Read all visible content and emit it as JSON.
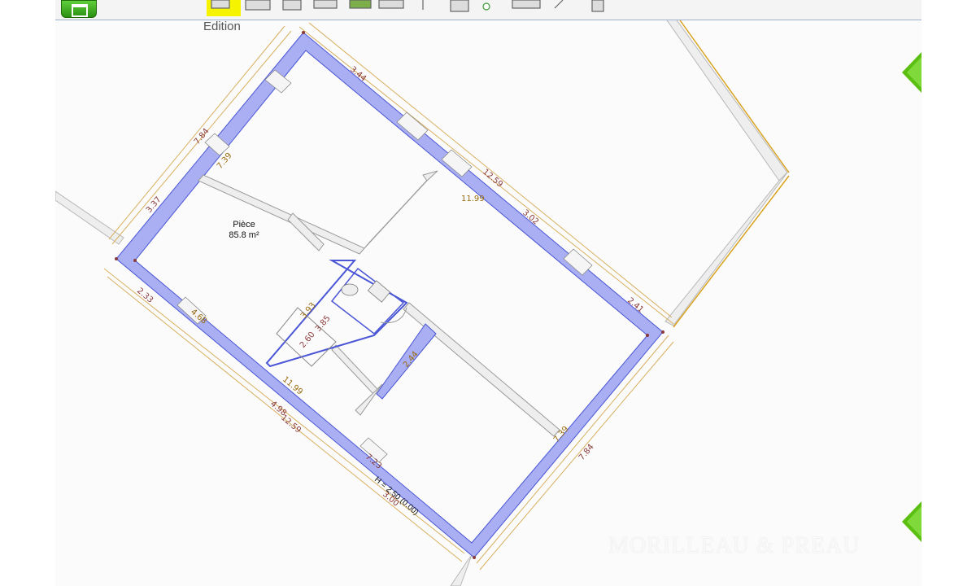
{
  "toolbar": {
    "edition_label": "Edition",
    "tools": [
      "app-icon",
      "select-tool",
      "wall-tool",
      "room-tool",
      "door-tool",
      "furniture-tool",
      "layers-tool",
      "dimension-tool",
      "text-tool",
      "cut-tool",
      "zoom-tool",
      "pen-tool",
      "add-tool"
    ]
  },
  "room": {
    "name": "Pièce",
    "area": "85.8 m²",
    "height_label": "H = 2.50 (0.00)"
  },
  "dimensions": {
    "top_segment": "3.44",
    "top_total": "12.59",
    "top_inner": "11.99",
    "top_right_a": "3.02",
    "top_right_b": "2.41",
    "left_outer": "7.84",
    "left_inner": "7.39",
    "left_lower": "3.37",
    "bottom_a": "2.33",
    "bottom_b": "4.68",
    "bottom_c": "4.98",
    "bottom_total": "12.59",
    "bottom_inner": "11.99",
    "bottom_d": "7.23",
    "bottom_e": "3.00",
    "right_outer": "7.84",
    "right_inner": "7.39",
    "partition_a": "3.93",
    "partition_b": "2.60",
    "partition_c": "3.85",
    "partition_d": "2.44"
  },
  "watermark": "MORILLEAU & PREAU",
  "colors": {
    "wall": "#a9aff2",
    "wall_stroke": "#4a56d6",
    "dimension": "#c8a04a",
    "dimension_text_a": "#8a3a3a",
    "dimension_text_b": "#9a6a10",
    "nav_green": "#5bbf12"
  }
}
